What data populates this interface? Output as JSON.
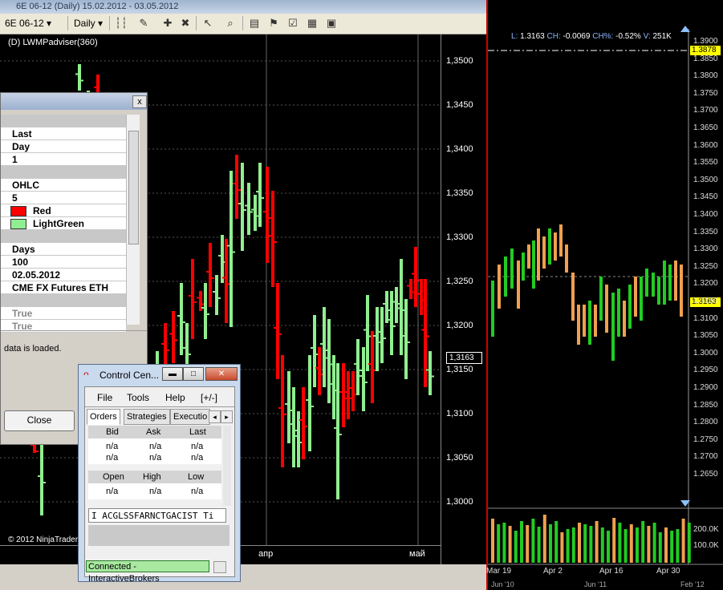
{
  "left_window": {
    "title": "6E 06-12 (Daily)  15.02.2012 - 03.05.2012",
    "toolbar": {
      "instrument": "6E 06-12",
      "period": "Daily"
    },
    "indicator_label": "(D) LWMPadviser(360)",
    "price_ticks": [
      "1,3500",
      "1,3450",
      "1,3400",
      "1,3350",
      "1,3300",
      "1,3250",
      "1,3200",
      "1,3150",
      "1,3100",
      "1,3050",
      "1,3000"
    ],
    "current_price_tag": "1,3163",
    "date_ticks": [
      "апр",
      "май"
    ],
    "copyright": "© 2012 NinjaTrader"
  },
  "right_window": {
    "info_line": {
      "low_label": "L:",
      "low_value": "1.3163",
      "ch_label": "CH:",
      "ch_value": "-0.0069",
      "chp_label": "CH%:",
      "chp_value": "-0.52%",
      "v_label": "V:",
      "v_value": "251K"
    },
    "price_ticks": [
      "1.3900",
      "1.3850",
      "1.3800",
      "1.3750",
      "1.3700",
      "1.3650",
      "1.3600",
      "1.3550",
      "1.3500",
      "1.3450",
      "1.3400",
      "1.3350",
      "1.3300",
      "1.3250",
      "1.3200",
      "1.3150",
      "1.3100",
      "1.3050",
      "1.3000",
      "1.2950",
      "1.2900",
      "1.2850",
      "1.2800",
      "1.2750",
      "1.2700",
      "1.2650"
    ],
    "highlight_tag_top": "1.3878",
    "highlight_tag_current": "1.3163",
    "volume_ticks": [
      "200.0K",
      "100.0K"
    ],
    "date_ticks": [
      "Mar 19",
      "Apr 2",
      "Apr 16",
      "Apr 30"
    ],
    "date_ticks_small": [
      "Jun '10",
      "Jun '11",
      "Feb '12"
    ]
  },
  "properties_dialog": {
    "rows": [
      {
        "type": "cat"
      },
      {
        "type": "val",
        "label": "Last"
      },
      {
        "type": "val",
        "label": "Day"
      },
      {
        "type": "val",
        "label": "1"
      },
      {
        "type": "cat"
      },
      {
        "type": "val",
        "label": "OHLC"
      },
      {
        "type": "val",
        "label": "5"
      },
      {
        "type": "color",
        "label": "Red",
        "color": "#ff0000"
      },
      {
        "type": "color",
        "label": "LightGreen",
        "color": "#90ee90"
      },
      {
        "type": "cat"
      },
      {
        "type": "val",
        "label": "Days"
      },
      {
        "type": "val",
        "label": "100"
      },
      {
        "type": "val",
        "label": "02.05.2012"
      },
      {
        "type": "val",
        "label": "CME FX Futures ETH"
      },
      {
        "type": "cat"
      },
      {
        "type": "val",
        "label": "True",
        "dim": true
      },
      {
        "type": "val",
        "label": "True",
        "dim": true
      }
    ],
    "note": "data is loaded.",
    "close_label": "Close"
  },
  "control_center": {
    "title": "Control Cen...",
    "menu": [
      "File",
      "Tools",
      "Help",
      "[+/-]"
    ],
    "tabs": [
      "Orders",
      "Strategies",
      "Executio"
    ],
    "quote_headers": [
      "Bid",
      "Ask",
      "Last"
    ],
    "quote_rows": [
      [
        "n/a",
        "n/a",
        "n/a"
      ],
      [
        "n/a",
        "n/a",
        "n/a"
      ]
    ],
    "range_headers": [
      "Open",
      "High",
      "Low"
    ],
    "range_row": [
      "n/a",
      "n/a",
      "n/a"
    ],
    "ticker": "I ACGLSSFARNCTGACIST Ti",
    "status": "Connected - InteractiveBrokers"
  },
  "colors": {
    "up_bar": "#90ee90",
    "down_bar": "#ff0000",
    "right_up": "#22cc22",
    "right_down": "#f0a050",
    "tag_yellow": "#ffff00"
  }
}
